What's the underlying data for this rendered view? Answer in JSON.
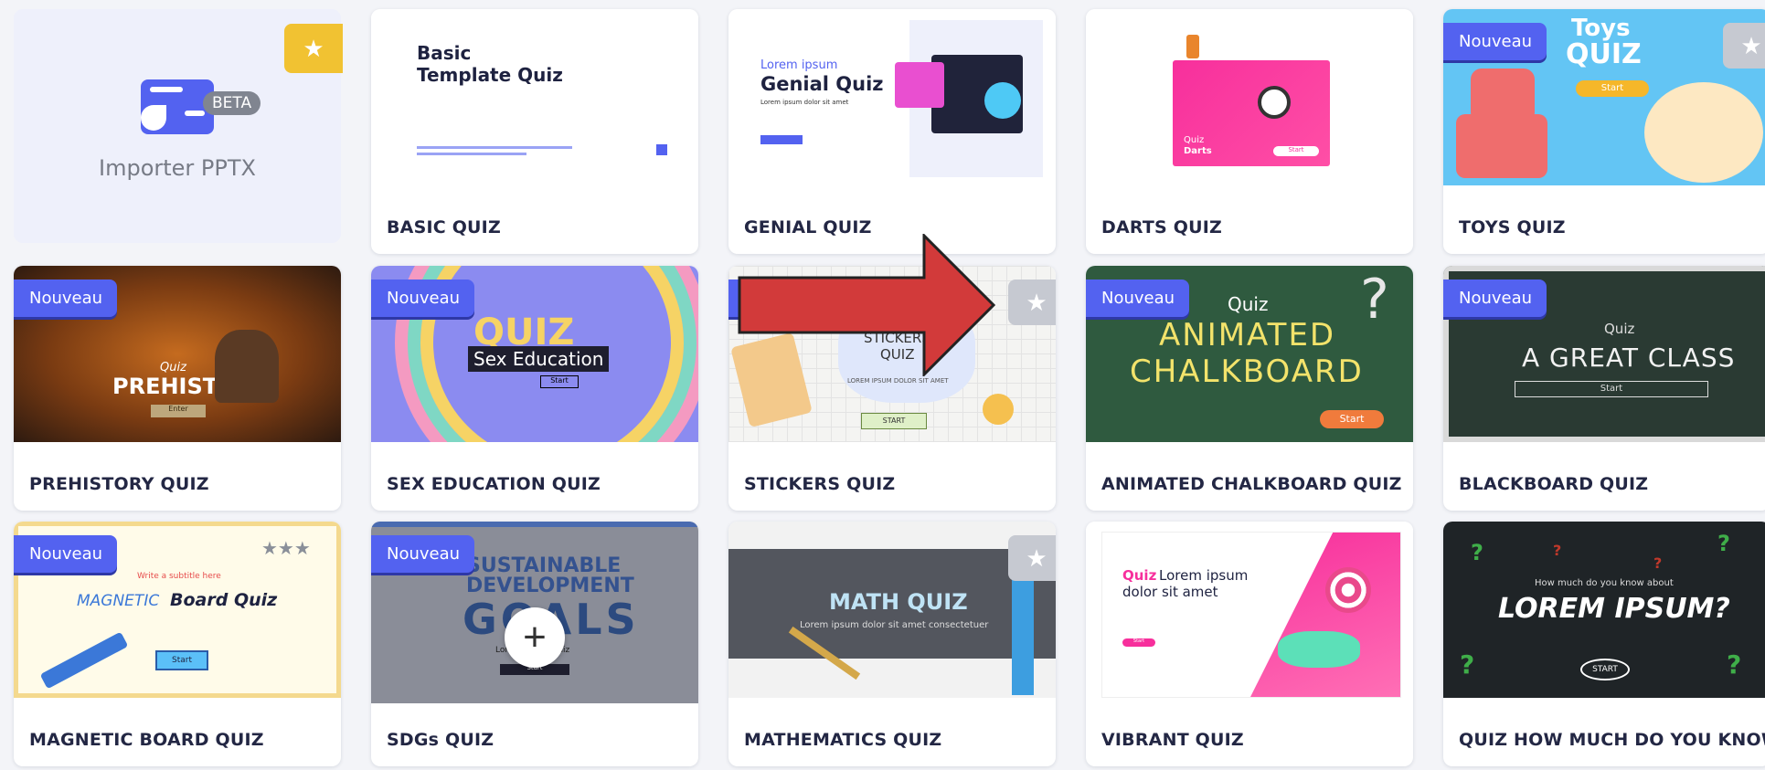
{
  "importer": {
    "label": "Importer PPTX",
    "beta": "BETA"
  },
  "badge_label": "Nouveau",
  "cards": [
    {
      "title": "BASIC QUIZ",
      "thumb_text": [
        "Basic",
        "Template Quiz"
      ]
    },
    {
      "title": "GENIAL QUIZ",
      "thumb_text": [
        "Lorem ipsum",
        "Genial Quiz",
        "Lorem ipsum dolor sit amet"
      ]
    },
    {
      "title": "DARTS QUIZ",
      "thumb_text": [
        "Quiz",
        "Darts",
        "Start"
      ]
    },
    {
      "title": "TOYS QUIZ",
      "thumb_text": [
        "Toys",
        "QUIZ",
        "Start"
      ]
    },
    {
      "title": "PREHISTORY QUIZ",
      "thumb_text": [
        "Quiz",
        "PREHISTORY",
        "Enter"
      ]
    },
    {
      "title": "SEX EDUCATION QUIZ",
      "thumb_text": [
        "QUIZ",
        "Sex Education",
        "Start"
      ]
    },
    {
      "title": "STICKERS QUIZ",
      "thumb_text": [
        "STICKERS",
        "QUIZ",
        "LOREM IPSUM DOLOR SIT AMET",
        "START"
      ]
    },
    {
      "title": "ANIMATED CHALKBOARD QUIZ",
      "thumb_text": [
        "Quiz",
        "ANIMATED",
        "CHALKBOARD",
        "Start"
      ]
    },
    {
      "title": "BLACKBOARD QUIZ",
      "thumb_text": [
        "Quiz",
        "A GREAT CLASS",
        "Start"
      ]
    },
    {
      "title": "MAGNETIC BOARD QUIZ",
      "thumb_text": [
        "Write a subtitle here",
        "MAGNETIC",
        "Board Quiz",
        "Start"
      ]
    },
    {
      "title": "SDGs QUIZ",
      "thumb_text": [
        "SUSTAINABLE",
        "DEVELOPMENT",
        "GOALS",
        "Lorem ipsum Quiz",
        "Start"
      ]
    },
    {
      "title": "MATHEMATICS QUIZ",
      "thumb_text": [
        "MATH QUIZ",
        "Lorem ipsum dolor sit amet consectetuer"
      ]
    },
    {
      "title": "VIBRANT QUIZ",
      "thumb_text": [
        "Quiz",
        "Lorem ipsum",
        "dolor sit amet",
        "Start"
      ]
    },
    {
      "title": "QUIZ HOW MUCH DO YOU KNOW",
      "thumb_text": [
        "How much do you know about",
        "LOREM IPSUM?",
        "START"
      ]
    }
  ],
  "icons": {
    "star": "star-icon",
    "plus": "plus-icon",
    "arrow": "red-arrow-annotation"
  },
  "colors": {
    "badge": "#5362f0",
    "star_gold": "#f1c232",
    "star_gray": "#c6c9d1",
    "arrow": "#d23a3a"
  }
}
